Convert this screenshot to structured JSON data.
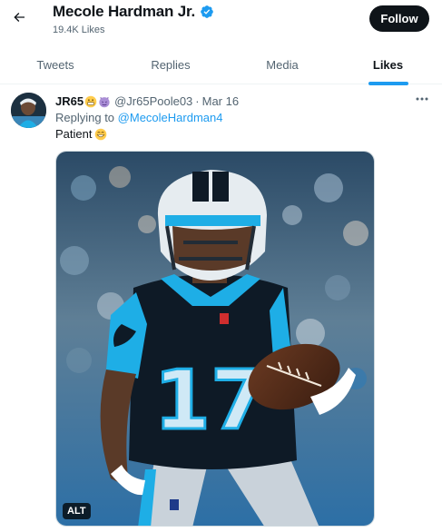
{
  "header": {
    "name": "Mecole Hardman Jr.",
    "likes": "19.4K Likes",
    "follow_label": "Follow"
  },
  "tabs": [
    {
      "label": "Tweets",
      "active": false
    },
    {
      "label": "Replies",
      "active": false
    },
    {
      "label": "Media",
      "active": false
    },
    {
      "label": "Likes",
      "active": true
    }
  ],
  "tweet": {
    "author": "JR65",
    "handle": "@Jr65Poole03",
    "separator": "·",
    "date": "Mar 16",
    "replying_prefix": "Replying to",
    "replying_handle": "@MecoleHardman4",
    "text": "Patient",
    "media_alt_badge": "ALT",
    "jersey_number": "17"
  },
  "icons": {
    "back": "back-arrow-icon",
    "verified": "verified-badge-icon",
    "more": "more-icon"
  },
  "colors": {
    "accent": "#1d9bf0",
    "follow_bg": "#0f1419",
    "panthers_blue": "#1eaee6"
  }
}
